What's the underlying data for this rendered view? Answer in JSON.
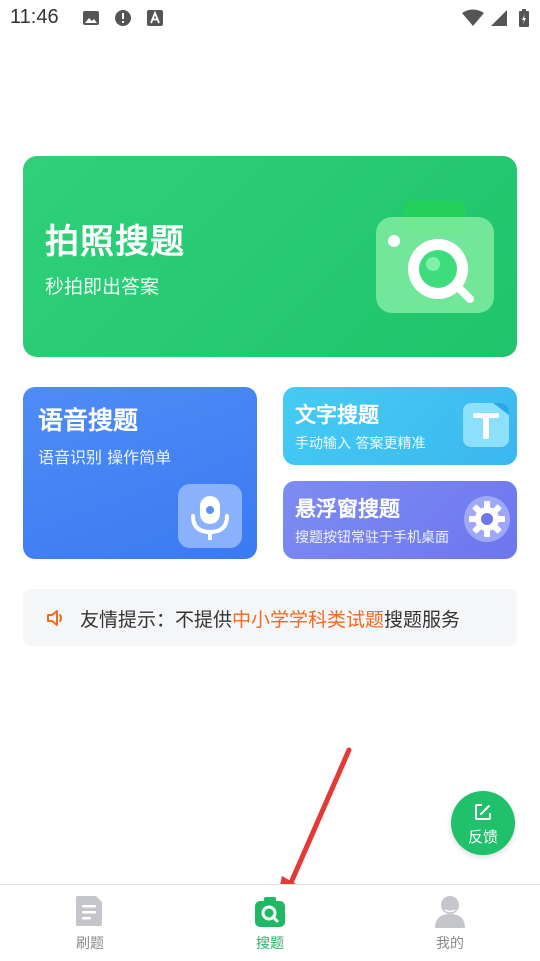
{
  "status_bar": {
    "time": "11:46"
  },
  "cards": {
    "photo": {
      "title": "拍照搜题",
      "subtitle": "秒拍即出答案"
    },
    "voice": {
      "title": "语音搜题",
      "subtitle": "语音识别 操作简单"
    },
    "text": {
      "title": "文字搜题",
      "subtitle": "手动输入 答案更精准"
    },
    "float": {
      "title": "悬浮窗搜题",
      "subtitle": "搜题按钮常驻于手机桌面"
    }
  },
  "notice": {
    "prefix": "友情提示：不提供",
    "highlight": "中小学学科类试题",
    "suffix": "搜题服务"
  },
  "feedback": {
    "label": "反馈"
  },
  "bottom_nav": {
    "items": [
      {
        "label": "刷题",
        "icon": "document-icon"
      },
      {
        "label": "搜题",
        "icon": "search-icon"
      },
      {
        "label": "我的",
        "icon": "user-icon"
      }
    ],
    "active": "搜题"
  },
  "colors": {
    "brand_green": "#21c06a",
    "voice_blue": "#4f8cf6",
    "text_cyan": "#45ccf2",
    "float_purple": "#7e8cf2",
    "highlight_orange": "#f36a1c",
    "annotation_red": "#e53935"
  }
}
